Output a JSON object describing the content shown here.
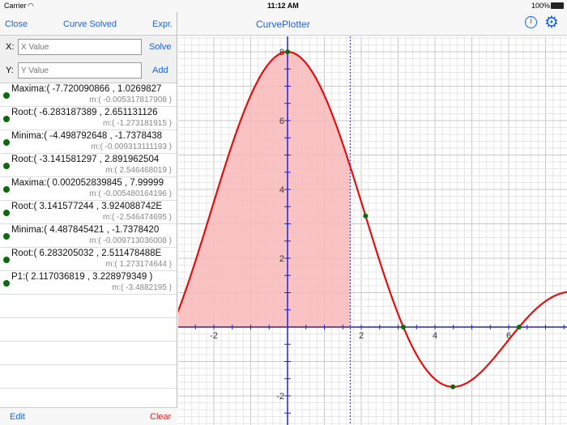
{
  "status": {
    "carrier": "Carrier",
    "time": "11:12 AM",
    "battery": "100%"
  },
  "left": {
    "close": "Close",
    "title": "Curve Solved",
    "expr": "Expr.",
    "x_label": "X:",
    "x_placeholder": "X Value",
    "solve": "Solve",
    "y_label": "Y:",
    "y_placeholder": "Y Value",
    "add": "Add",
    "items": [
      {
        "text": "Maxima:( -7.720090866 , 1.0269827",
        "m": "m:( -0.005317817908 )"
      },
      {
        "text": "Root:( -6.283187389 , 2.651131126",
        "m": "m:( -1.273181915 )"
      },
      {
        "text": "Minima:( -4.498792648 , -1.7378438",
        "m": "m:( -0.009313111193 )"
      },
      {
        "text": "Root:( -3.141581297 , 2.891962504",
        "m": "m:( 2.546468019 )"
      },
      {
        "text": "Maxima:( 0.002052839845 , 7.99999",
        "m": "m:( -0.005480164196 )"
      },
      {
        "text": "Root:( 3.141577244 , 3.924088742E",
        "m": "m:( -2.546474695 )"
      },
      {
        "text": "Minima:( 4.487845421 , -1.7378420",
        "m": "m:( -0.009713036008 )"
      },
      {
        "text": "Root:( 6.283205032 , 2.511478488E",
        "m": "m:( 1.273174644 )"
      },
      {
        "text": "P1:( 2.117036819 , 3.228979349 )",
        "m": "m:( -3.4882195 )"
      }
    ],
    "edit": "Edit",
    "clear": "Clear"
  },
  "right": {
    "title": "CurvePlotter",
    "info_icon": "info-icon",
    "settings_icon": "gear-icon"
  },
  "plot": {
    "x_ticks": [
      "-2",
      "2",
      "4",
      "6"
    ],
    "y_ticks": [
      "8",
      "6",
      "4",
      "2",
      "-2"
    ],
    "curve_color": "#e01010",
    "fill_color": "#f9b8b8",
    "axis_color": "#2020e0",
    "point_color": "#0a6b0a",
    "points": [
      [
        0.002052839845,
        7.99999
      ],
      [
        2.117036819,
        3.228979349
      ],
      [
        3.141577244,
        0
      ],
      [
        4.487845421,
        -1.737842
      ],
      [
        6.283205032,
        0
      ]
    ],
    "shade_to_x": 1.7
  }
}
